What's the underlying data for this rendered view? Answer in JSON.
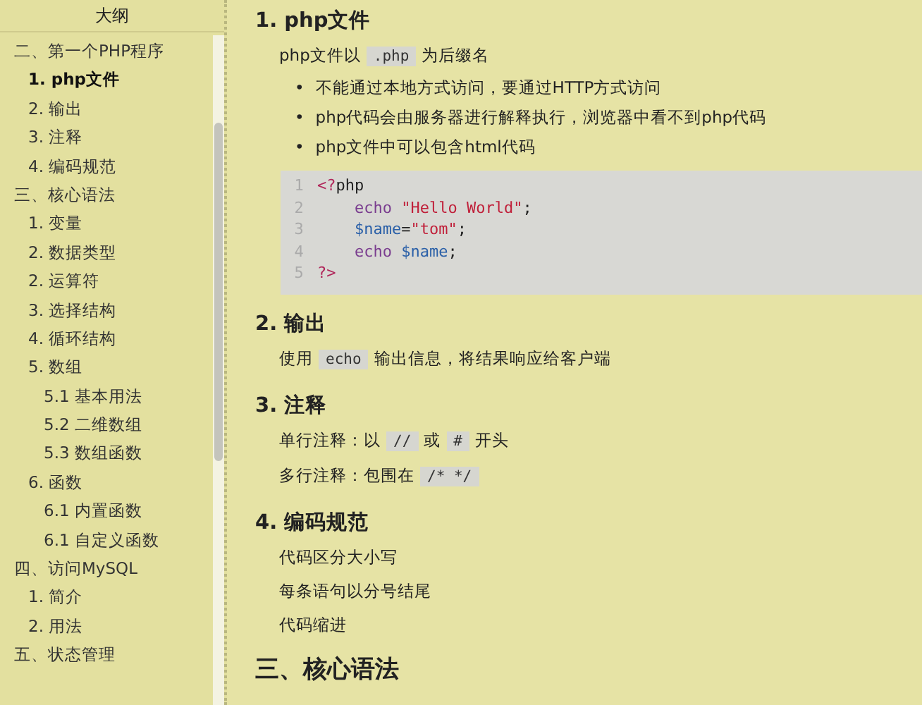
{
  "sidebar": {
    "title": "大纲",
    "items": [
      {
        "label": "二、第一个PHP程序",
        "selected": false,
        "children": [
          {
            "label": "1. php文件",
            "selected": true
          },
          {
            "label": "2. 输出",
            "selected": false
          },
          {
            "label": "3. 注释",
            "selected": false
          },
          {
            "label": "4. 编码规范",
            "selected": false
          }
        ]
      },
      {
        "label": "三、核心语法",
        "selected": false,
        "children": [
          {
            "label": "1. 变量",
            "selected": false
          },
          {
            "label": "2. 数据类型",
            "selected": false
          },
          {
            "label": "2. 运算符",
            "selected": false
          },
          {
            "label": "3. 选择结构",
            "selected": false
          },
          {
            "label": "4. 循环结构",
            "selected": false
          },
          {
            "label": "5. 数组",
            "selected": false,
            "children": [
              {
                "label": "5.1 基本用法",
                "selected": false
              },
              {
                "label": "5.2 二维数组",
                "selected": false
              },
              {
                "label": "5.3 数组函数",
                "selected": false
              }
            ]
          },
          {
            "label": "6. 函数",
            "selected": false,
            "children": [
              {
                "label": "6.1 内置函数",
                "selected": false
              },
              {
                "label": "6.1 自定义函数",
                "selected": false
              }
            ]
          }
        ]
      },
      {
        "label": "四、访问MySQL",
        "selected": false,
        "children": [
          {
            "label": "1. 简介",
            "selected": false
          },
          {
            "label": "2. 用法",
            "selected": false
          }
        ]
      },
      {
        "label": "五、状态管理",
        "selected": false
      }
    ]
  },
  "content": [
    {
      "kind": "heading",
      "text": "1. php文件"
    },
    {
      "kind": "paragraph",
      "parts": [
        {
          "kind": "text",
          "text": "php文件以"
        },
        {
          "kind": "code",
          "text": ".php"
        },
        {
          "kind": "text",
          "text": "为后缀名"
        }
      ]
    },
    {
      "kind": "bullets",
      "marker": "•",
      "items": [
        "不能通过本地方式访问，要通过HTTP方式访问",
        "php代码会由服务器进行解释执行，浏览器中看不到php代码",
        "php文件中可以包含html代码"
      ]
    },
    {
      "kind": "codeblock",
      "lines": [
        {
          "number": "1",
          "indented": false,
          "tokens": [
            {
              "kind": "tag",
              "text": "<?"
            },
            {
              "kind": "plain",
              "text": "php"
            }
          ]
        },
        {
          "number": "2",
          "indented": true,
          "tokens": [
            {
              "kind": "keyword",
              "text": "echo "
            },
            {
              "kind": "string",
              "text": "\"Hello World\""
            },
            {
              "kind": "plain",
              "text": ";"
            }
          ]
        },
        {
          "number": "3",
          "indented": true,
          "tokens": [
            {
              "kind": "variable",
              "text": "$name"
            },
            {
              "kind": "plain",
              "text": "="
            },
            {
              "kind": "string",
              "text": "\"tom\""
            },
            {
              "kind": "plain",
              "text": ";"
            }
          ]
        },
        {
          "number": "4",
          "indented": true,
          "tokens": [
            {
              "kind": "keyword",
              "text": "echo "
            },
            {
              "kind": "variable",
              "text": "$name"
            },
            {
              "kind": "plain",
              "text": ";"
            }
          ]
        },
        {
          "number": "5",
          "indented": false,
          "tokens": [
            {
              "kind": "tag",
              "text": "?>"
            }
          ]
        }
      ]
    },
    {
      "kind": "heading",
      "text": "2. 输出"
    },
    {
      "kind": "paragraph",
      "parts": [
        {
          "kind": "text",
          "text": "使用"
        },
        {
          "kind": "code",
          "text": "echo"
        },
        {
          "kind": "text",
          "text": "输出信息，将结果响应给客户端"
        }
      ]
    },
    {
      "kind": "heading",
      "text": "3. 注释"
    },
    {
      "kind": "paragraph",
      "parts": [
        {
          "kind": "text",
          "text": "单行注释：以"
        },
        {
          "kind": "code",
          "text": "//"
        },
        {
          "kind": "text",
          "text": "或"
        },
        {
          "kind": "code",
          "text": "#"
        },
        {
          "kind": "text",
          "text": "开头"
        }
      ]
    },
    {
      "kind": "paragraph",
      "parts": [
        {
          "kind": "text",
          "text": "多行注释：包围在"
        },
        {
          "kind": "code",
          "text": "/*  */"
        }
      ]
    },
    {
      "kind": "heading",
      "text": "4. 编码规范"
    },
    {
      "kind": "paragraph",
      "parts": [
        {
          "kind": "text",
          "text": "代码区分大小写"
        }
      ]
    },
    {
      "kind": "paragraph",
      "parts": [
        {
          "kind": "text",
          "text": "每条语句以分号结尾"
        }
      ]
    },
    {
      "kind": "paragraph",
      "parts": [
        {
          "kind": "text",
          "text": "代码缩进"
        }
      ]
    },
    {
      "kind": "chapter",
      "text": "三、核心语法"
    }
  ]
}
